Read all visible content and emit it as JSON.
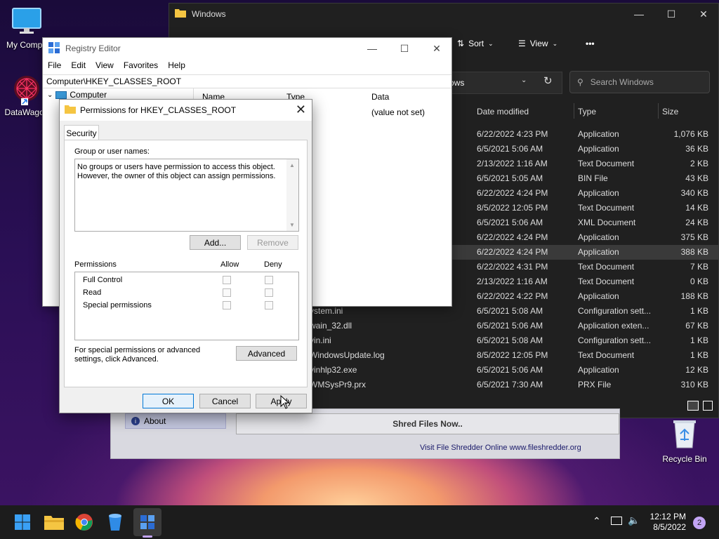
{
  "desktop": {
    "icons": [
      {
        "label": "My Compu"
      },
      {
        "label": "DataWagon"
      },
      {
        "label": "Recycle Bin"
      }
    ]
  },
  "explorer": {
    "title": "Windows",
    "sort_label": "Sort",
    "view_label": "View",
    "more_label": "•••",
    "address_text": "ows",
    "search_placeholder": "Search Windows",
    "columns": {
      "date": "Date modified",
      "type": "Type",
      "size": "Size"
    },
    "rows": [
      {
        "name": "",
        "date": "6/22/2022 4:23 PM",
        "type": "Application",
        "size": "1,076 KB"
      },
      {
        "name": "",
        "date": "6/5/2021 5:06 AM",
        "type": "Application",
        "size": "36 KB"
      },
      {
        "name": "",
        "date": "2/13/2022 1:16 AM",
        "type": "Text Document",
        "size": "2 KB"
      },
      {
        "name": "",
        "date": "6/5/2021 5:05 AM",
        "type": "BIN File",
        "size": "43 KB"
      },
      {
        "name": "",
        "date": "6/22/2022 4:24 PM",
        "type": "Application",
        "size": "340 KB"
      },
      {
        "name": "",
        "date": "8/5/2022 12:05 PM",
        "type": "Text Document",
        "size": "14 KB"
      },
      {
        "name": "",
        "date": "6/5/2021 5:06 AM",
        "type": "XML Document",
        "size": "24 KB"
      },
      {
        "name": "",
        "date": "6/22/2022 4:24 PM",
        "type": "Application",
        "size": "375 KB"
      },
      {
        "name": "",
        "date": "6/22/2022 4:24 PM",
        "type": "Application",
        "size": "388 KB"
      },
      {
        "name": "",
        "date": "6/22/2022 4:31 PM",
        "type": "Text Document",
        "size": "7 KB"
      },
      {
        "name": "",
        "date": "2/13/2022 1:16 AM",
        "type": "Text Document",
        "size": "0 KB"
      },
      {
        "name": "",
        "date": "6/22/2022 4:22 PM",
        "type": "Application",
        "size": "188 KB"
      },
      {
        "name": "ystem.ini",
        "date": "6/5/2021 5:08 AM",
        "type": "Configuration sett...",
        "size": "1 KB"
      },
      {
        "name": "wain_32.dll",
        "date": "6/5/2021 5:06 AM",
        "type": "Application exten...",
        "size": "67 KB"
      },
      {
        "name": "vin.ini",
        "date": "6/5/2021 5:08 AM",
        "type": "Configuration sett...",
        "size": "1 KB"
      },
      {
        "name": "WindowsUpdate.log",
        "date": "8/5/2022 12:05 PM",
        "type": "Text Document",
        "size": "1 KB"
      },
      {
        "name": "vinhlp32.exe",
        "date": "6/5/2021 5:06 AM",
        "type": "Application",
        "size": "12 KB"
      },
      {
        "name": "WMSysPr9.prx",
        "date": "6/5/2021 7:30 AM",
        "type": "PRX File",
        "size": "310 KB"
      }
    ]
  },
  "shredder": {
    "about_label": "About",
    "shred_button": "Shred Files Now..",
    "footer": "Visit File Shredder Online   www.fileshredder.org"
  },
  "regedit": {
    "title": "Registry Editor",
    "menu": [
      "File",
      "Edit",
      "View",
      "Favorites",
      "Help"
    ],
    "path": "Computer\\HKEY_CLASSES_ROOT",
    "tree_root": "Computer",
    "columns": {
      "name": "Name",
      "type": "Type",
      "data": "Data"
    },
    "default_value": "(value not set)"
  },
  "permissions": {
    "title": "Permissions for HKEY_CLASSES_ROOT",
    "tab_security": "Security",
    "group_label": "Group or user names:",
    "group_message": "No groups or users have permission to access this object. However, the owner of this object can assign permissions.",
    "add_button": "Add...",
    "remove_button": "Remove",
    "permissions_label": "Permissions",
    "allow_label": "Allow",
    "deny_label": "Deny",
    "perm_rows": [
      {
        "label": "Full Control"
      },
      {
        "label": "Read"
      },
      {
        "label": "Special permissions"
      }
    ],
    "advanced_text": "For special permissions or advanced settings, click Advanced.",
    "advanced_button": "Advanced",
    "ok_button": "OK",
    "cancel_button": "Cancel",
    "apply_button": "Apply"
  },
  "taskbar": {
    "time": "12:12 PM",
    "date": "8/5/2022",
    "notification_count": "2"
  },
  "colors": {
    "accent": "#c3a5f5",
    "explorer_bg": "#202020",
    "taskbar_bg": "#1c1c1c"
  }
}
